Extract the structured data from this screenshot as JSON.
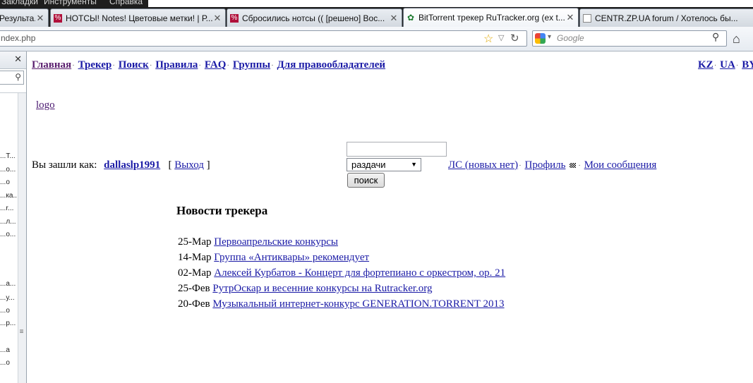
{
  "menubar": {
    "items": [
      "Закладки",
      "Инструменты",
      "Справка"
    ]
  },
  "tabs": [
    {
      "label": "Результа...",
      "favicon": "page-icon",
      "active": false
    },
    {
      "label": "НОТСЫ! Notes! Цветовые метки! | Р...",
      "favicon": "percent-icon",
      "active": false
    },
    {
      "label": "Сбросились нотсы (( [решено] Вос...",
      "favicon": "percent-icon",
      "active": false
    },
    {
      "label": "BitTorrent трекер RuTracker.org (ex t...",
      "favicon": "torrent-icon",
      "active": true
    },
    {
      "label": "CENTR.ZP.UA forum / Хотелось бы...",
      "favicon": "page-icon",
      "active": false
    }
  ],
  "navbar": {
    "url": "ndex.php",
    "search_placeholder": "Google"
  },
  "sidebar": {
    "items": [
      "...T...",
      "...о...",
      "...о",
      "...ка...",
      "...r...",
      "...л...",
      "...о...",
      "...а...",
      "...у...",
      "...о",
      "...р...",
      "...а",
      "...о"
    ]
  },
  "page": {
    "nav": [
      "Главная",
      "Трекер",
      "Поиск",
      "Правила",
      "FAQ",
      "Группы",
      "Для правообладателей"
    ],
    "langs": [
      "KZ",
      "UA",
      "BY"
    ],
    "logo": "logo",
    "logged_in_label": "Вы зашли как:",
    "username": "dallaslp1991",
    "logout": "Выход",
    "search_select_value": "раздачи",
    "search_button": "поиск",
    "pm": "ЛС (новых нет)",
    "profile": "Профиль",
    "my_messages": "Мои сообщения",
    "news_title": "Новости трекера",
    "news": [
      {
        "date": "25-Мар",
        "title": "Первоапрельские конкурсы"
      },
      {
        "date": "14-Мар",
        "title": "Группа «Антиквары» рекомендует"
      },
      {
        "date": "02-Мар",
        "title": "Алексей Курбатов - Концерт для фортепиано с оркестром, ор. 21"
      },
      {
        "date": "25-Фев",
        "title": "РутрОскар и весенние конкурсы на Rutracker.org"
      },
      {
        "date": "20-Фев",
        "title": "Музыкальный интернет-конкурс GENERATION.TORRENT 2013"
      }
    ]
  },
  "colors": {
    "link": "#1a1aa6",
    "visited": "#5a1e6e",
    "chrome_dark": "#1e1e1e"
  }
}
